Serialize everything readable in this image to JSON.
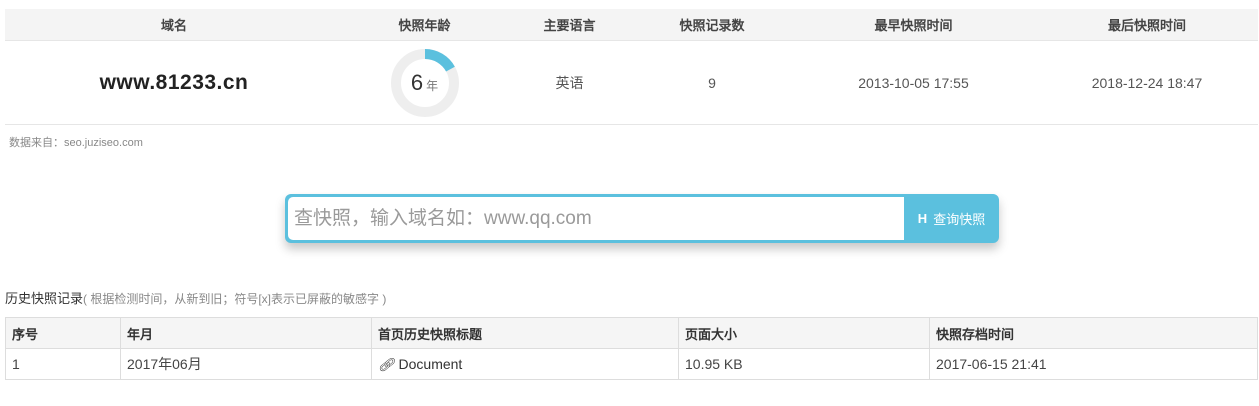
{
  "summary": {
    "headers": [
      "域名",
      "快照年龄",
      "主要语言",
      "快照记录数",
      "最早快照时间",
      "最后快照时间"
    ],
    "domain": "www.81233.cn",
    "age_value": "6",
    "age_unit": "年",
    "age_fraction": 0.17,
    "language": "英语",
    "record_count": "9",
    "earliest": "2013-10-05 17:55",
    "latest": "2018-12-24 18:47"
  },
  "source_text": "数据来自：seo.juziseo.com",
  "search": {
    "placeholder": "查快照，输入域名如：www.qq.com",
    "button_icon": "H",
    "button_label": "查询快照"
  },
  "history": {
    "title": "历史快照记录",
    "note": "( 根据检测时间，从新到旧；符号[x]表示已屏蔽的敏感字 )",
    "columns": [
      "序号",
      "年月",
      "首页历史快照标题",
      "页面大小",
      "快照存档时间"
    ],
    "rows": [
      [
        "1",
        "2017年06月",
        "Document",
        "10.95 KB",
        "2017-06-15 21:41"
      ]
    ]
  },
  "colors": {
    "accent": "#5bc0de",
    "ring_track": "#eeeeee"
  },
  "icons": {
    "link": "link-icon"
  }
}
